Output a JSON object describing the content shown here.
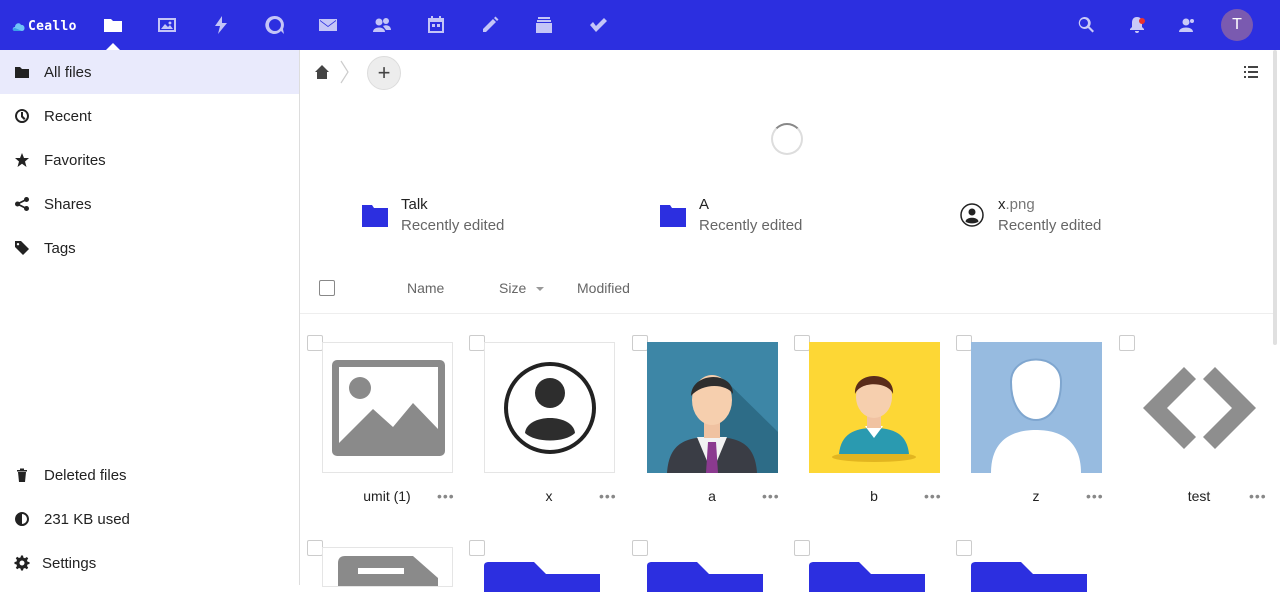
{
  "header": {
    "logo_text": "Ceallo",
    "apps": [
      {
        "name": "files",
        "icon": "folder-icon",
        "active": true
      },
      {
        "name": "photos",
        "icon": "image-icon"
      },
      {
        "name": "activity",
        "icon": "bolt-icon"
      },
      {
        "name": "talk",
        "icon": "chat-icon"
      },
      {
        "name": "mail",
        "icon": "mail-icon"
      },
      {
        "name": "contacts",
        "icon": "contacts-icon"
      },
      {
        "name": "calendar",
        "icon": "calendar-icon"
      },
      {
        "name": "notes",
        "icon": "pencil-icon"
      },
      {
        "name": "deck",
        "icon": "deck-icon"
      },
      {
        "name": "tasks",
        "icon": "check-icon"
      }
    ],
    "avatar_initial": "T",
    "accent": "#2c2fe0"
  },
  "sidebar": {
    "items": [
      {
        "label": "All files",
        "icon": "folder-icon"
      },
      {
        "label": "Recent",
        "icon": "clock-icon"
      },
      {
        "label": "Favorites",
        "icon": "star-icon"
      },
      {
        "label": "Shares",
        "icon": "share-icon"
      },
      {
        "label": "Tags",
        "icon": "tag-icon"
      }
    ],
    "bottom": [
      {
        "label": "Deleted files",
        "icon": "trash-icon"
      },
      {
        "label": "231 KB used",
        "icon": "quota-pie-icon"
      },
      {
        "label": "Settings",
        "icon": "gear-icon"
      }
    ]
  },
  "main": {
    "recent": [
      {
        "name": "Talk",
        "ext": "",
        "sub": "Recently edited",
        "icon": "folder-icon"
      },
      {
        "name": "A",
        "ext": "",
        "sub": "Recently edited",
        "icon": "folder-icon"
      },
      {
        "name": "x",
        "ext": ".png",
        "sub": "Recently edited",
        "icon": "user-circle-icon"
      }
    ],
    "columns": {
      "name": "Name",
      "size": "Size",
      "modified": "Modified"
    },
    "files": [
      {
        "name": "umit (1)",
        "thumb": "image-placeholder-icon"
      },
      {
        "name": "x",
        "thumb": "user-circle-icon"
      },
      {
        "name": "a",
        "thumb": "businessman-avatar"
      },
      {
        "name": "b",
        "thumb": "man-avatar"
      },
      {
        "name": "z",
        "thumb": "user-silhouette"
      },
      {
        "name": "test",
        "thumb": "code-icon"
      }
    ],
    "menu_glyph": "•••",
    "add_glyph": "+"
  }
}
